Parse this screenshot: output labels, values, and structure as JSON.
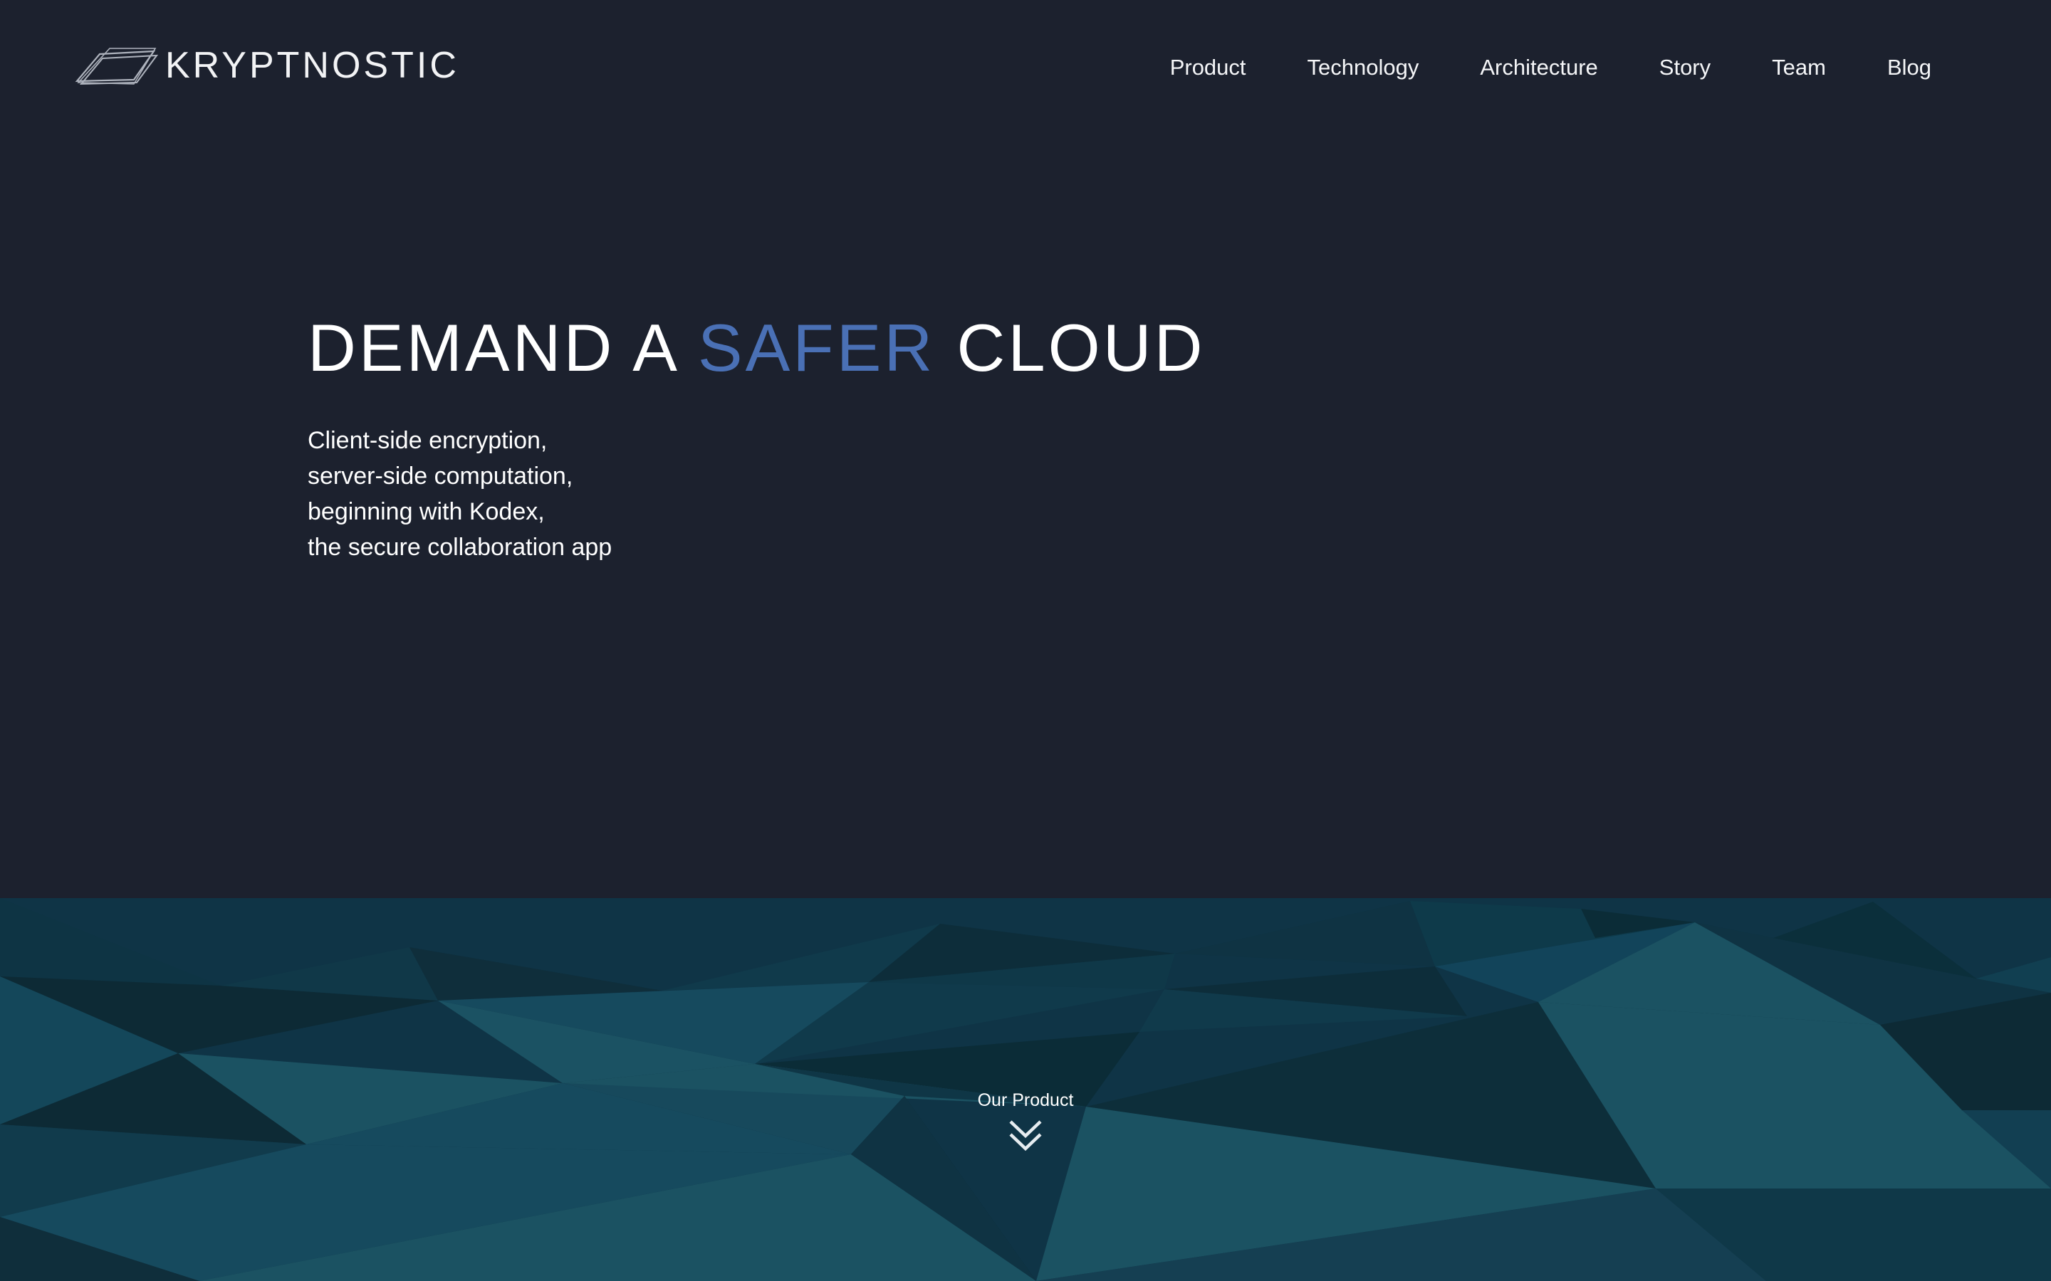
{
  "brand": {
    "name": "KRYPTNOSTIC",
    "logo_icon": "layered-sheets-logo-icon"
  },
  "nav": {
    "items": [
      {
        "label": "Product"
      },
      {
        "label": "Technology"
      },
      {
        "label": "Architecture"
      },
      {
        "label": "Story"
      },
      {
        "label": "Team"
      },
      {
        "label": "Blog"
      }
    ]
  },
  "hero": {
    "title_part1": "DEMAND A ",
    "title_accent": "SAFER",
    "title_part2": " CLOUD",
    "subtitle_lines": [
      "Client-side encryption,",
      "server-side computation,",
      "beginning with Kodex,",
      "the secure collaboration app"
    ]
  },
  "scroll_cue": {
    "label": "Our Product",
    "icon": "double-chevron-down-icon"
  },
  "colors": {
    "background": "#1c212e",
    "accent": "#4a70b5",
    "text": "#ffffff",
    "polygon_palette": [
      "#0f2e3d",
      "#0d2a35",
      "#0f3746",
      "#164a5e",
      "#1b5262",
      "#123d4e"
    ]
  }
}
